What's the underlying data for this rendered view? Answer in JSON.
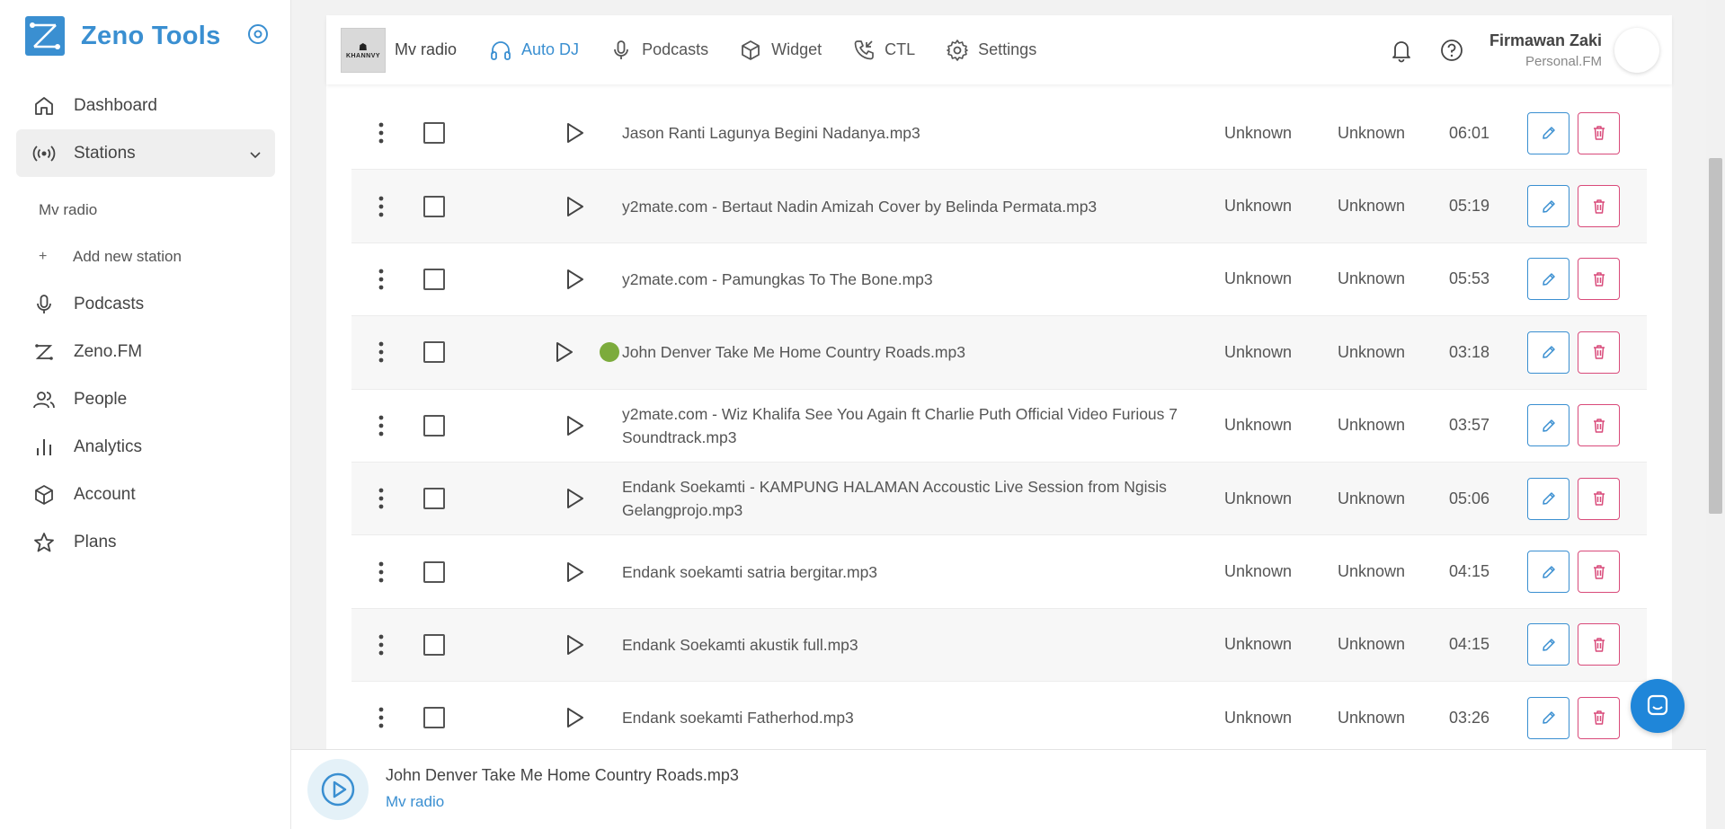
{
  "brand": {
    "name": "Zeno Tools"
  },
  "sidebar": {
    "items": [
      {
        "label": "Dashboard"
      },
      {
        "label": "Stations"
      },
      {
        "label": "Podcasts"
      },
      {
        "label": "Zeno.FM"
      },
      {
        "label": "People"
      },
      {
        "label": "Analytics"
      },
      {
        "label": "Account"
      },
      {
        "label": "Plans"
      }
    ],
    "station_name": "Mv radio",
    "add_station": "Add new station",
    "add_symbol": "+"
  },
  "topbar": {
    "station_name": "Mv radio",
    "thumb_text": "KHANNVY",
    "tabs": [
      {
        "label": "Auto DJ"
      },
      {
        "label": "Podcasts"
      },
      {
        "label": "Widget"
      },
      {
        "label": "CTL"
      },
      {
        "label": "Settings"
      }
    ],
    "user_name": "Firmawan Zaki",
    "user_sub": "Personal.FM"
  },
  "tracks": [
    {
      "title": "Jason Ranti Lagunya Begini Nadanya.mp3",
      "artist": "Unknown",
      "album": "Unknown",
      "duration": "06:01"
    },
    {
      "title": "y2mate.com - Bertaut Nadin Amizah Cover by Belinda Permata.mp3",
      "artist": "Unknown",
      "album": "Unknown",
      "duration": "05:19"
    },
    {
      "title": "y2mate.com - Pamungkas To The Bone.mp3",
      "artist": "Unknown",
      "album": "Unknown",
      "duration": "05:53"
    },
    {
      "title": "John Denver Take Me Home Country Roads.mp3",
      "artist": "Unknown",
      "album": "Unknown",
      "duration": "03:18"
    },
    {
      "title": "y2mate.com - Wiz Khalifa See You Again ft Charlie Puth Official Video Furious 7 Soundtrack.mp3",
      "artist": "Unknown",
      "album": "Unknown",
      "duration": "03:57"
    },
    {
      "title": "Endank Soekamti - KAMPUNG HALAMAN Accoustic Live Session from Ngisis Gelangprojo.mp3",
      "artist": "Unknown",
      "album": "Unknown",
      "duration": "05:06"
    },
    {
      "title": "Endank soekamti satria bergitar.mp3",
      "artist": "Unknown",
      "album": "Unknown",
      "duration": "04:15"
    },
    {
      "title": "Endank Soekamti akustik full.mp3",
      "artist": "Unknown",
      "album": "Unknown",
      "duration": "04:15"
    },
    {
      "title": "Endank soekamti Fatherhod.mp3",
      "artist": "Unknown",
      "album": "Unknown",
      "duration": "03:26"
    }
  ],
  "player": {
    "title": "John Denver Take Me Home Country Roads.mp3",
    "station": "Mv radio"
  },
  "colors": {
    "accent": "#3a8fd1",
    "delete": "#d94a7a",
    "playing": "#7cab3c",
    "chat": "#1f86d9"
  }
}
